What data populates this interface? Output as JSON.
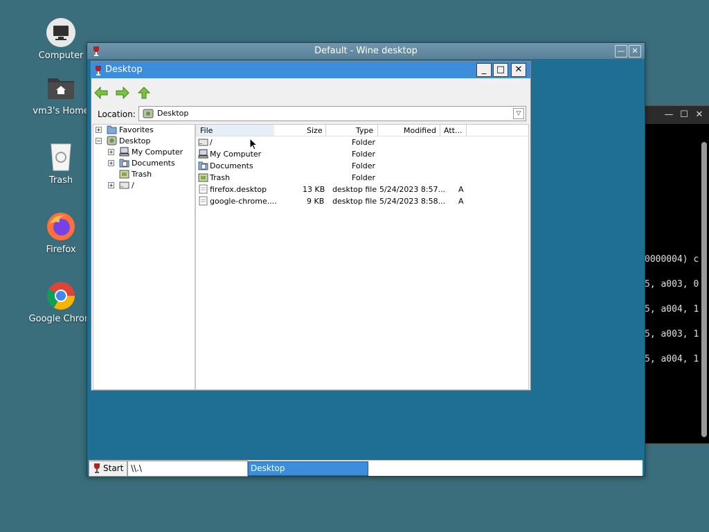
{
  "desktop": {
    "icons": [
      {
        "label": "Computer"
      },
      {
        "label": "vm3's Home"
      },
      {
        "label": "Trash"
      },
      {
        "label": "Firefox"
      },
      {
        "label": "Google Chrom"
      }
    ]
  },
  "terminal": {
    "lines": [
      "0000004) c",
      "5, a003, 0",
      "5, a004, 1",
      "5, a003, 1",
      "5, a004, 1"
    ],
    "controls": {
      "minimize": "—",
      "maximize": "☐",
      "close": "✕"
    }
  },
  "wine_window": {
    "title": "Default - Wine desktop",
    "controls": {
      "minimize": "—",
      "close": "✕"
    }
  },
  "explorer": {
    "title": "Desktop",
    "controls": {
      "minimize": "_",
      "maximize": "□",
      "close": "✕"
    },
    "location_label": "Location:",
    "location_value": "Desktop",
    "tree": [
      {
        "label": "Favorites",
        "expander": "+"
      },
      {
        "label": "Desktop",
        "expander": "−"
      },
      {
        "label": "My Computer",
        "expander": "+"
      },
      {
        "label": "Documents",
        "expander": "+"
      },
      {
        "label": "Trash",
        "expander": ""
      },
      {
        "label": "/",
        "expander": "+"
      }
    ],
    "columns": [
      "File",
      "Size",
      "Type",
      "Modified",
      "Att..."
    ],
    "rows": [
      {
        "name": "/",
        "size": "",
        "type": "Folder",
        "modified": "",
        "attr": ""
      },
      {
        "name": "My Computer",
        "size": "",
        "type": "Folder",
        "modified": "",
        "attr": ""
      },
      {
        "name": "Documents",
        "size": "",
        "type": "Folder",
        "modified": "",
        "attr": ""
      },
      {
        "name": "Trash",
        "size": "",
        "type": "Folder",
        "modified": "",
        "attr": ""
      },
      {
        "name": "firefox.desktop",
        "size": "13 KB",
        "type": "desktop file",
        "modified": "5/24/2023 8:57...",
        "attr": "A"
      },
      {
        "name": "google-chrome....",
        "size": "9 KB",
        "type": "desktop file",
        "modified": "5/24/2023 8:58...",
        "attr": "A"
      }
    ]
  },
  "taskbar": {
    "start_label": "Start",
    "path": "\\\\.\\",
    "task_label": "Desktop"
  },
  "colors": {
    "desktop_bg": "#3b6e7c",
    "wine_bg": "#1f6f95",
    "selection": "#3c8ddc"
  }
}
